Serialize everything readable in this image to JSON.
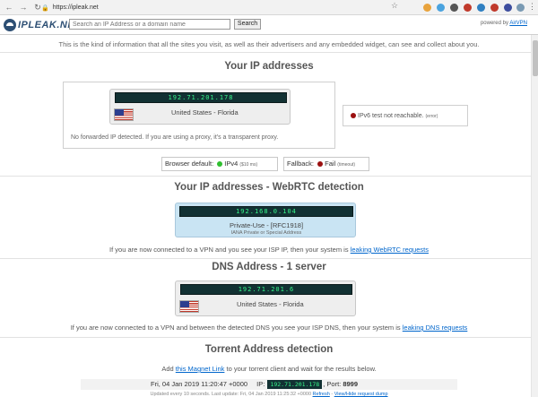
{
  "browser": {
    "url": "https://ipleak.net"
  },
  "header": {
    "logo_text": "IPLEAK.NET",
    "search_placeholder": "Search an IP Address or a domain name",
    "search_button": "Search",
    "powered_by_prefix": "powered by",
    "powered_by_link": "AirVPN"
  },
  "intro": "This is the kind of information that all the sites you visit, as well as their advertisers and any embedded widget, can see and collect about you.",
  "ip_section": {
    "title": "Your IP addresses",
    "ipv4": "192.71.201.178",
    "location": "United States - Florida",
    "no_forward": "No forwarded IP detected. If you are using a proxy, it's a transparent proxy.",
    "ipv6_text": "IPv6 test not reachable.",
    "ipv6_tag": "(error)",
    "browser_default_label": "Browser default:",
    "browser_default_value": "IPv4",
    "browser_default_tag": "($10 ms)",
    "fallback_label": "Fallback:",
    "fallback_value": "Fail",
    "fallback_tag": "(timeout)"
  },
  "webrtc_section": {
    "title": "Your IP addresses - WebRTC detection",
    "ip": "192.168.0.104",
    "label": "Private-Use - [RFC1918]",
    "sublabel": "IANA Private or Special Address",
    "note_prefix": "If you are now connected to a VPN and you see your ISP IP, then your system is",
    "note_link": "leaking WebRTC requests"
  },
  "dns_section": {
    "title": "DNS Address - 1 server",
    "ip": "192.71.201.6",
    "location": "United States - Florida",
    "note_prefix": "If you are now connected to a VPN and between the detected DNS you see your ISP DNS, then your system is",
    "note_link": "leaking DNS requests"
  },
  "torrent_section": {
    "title": "Torrent Address detection",
    "add_prefix": "Add",
    "add_link": "this Magnet Link",
    "add_suffix": "to your torrent client and wait for the results below.",
    "date": "Fri, 04 Jan 2019 11:20:47 +0000",
    "ip_label": "IP:",
    "ip": "192.71.201.178",
    "port_label": ", Port:",
    "port": "8999",
    "updated": "Updated every 10 seconds. Last update: Fri, 04 Jan 2019 11:25:32 +0000",
    "refresh_link": "Refresh",
    "view_link": "View/Hide request dump"
  },
  "colors": {
    "screen_bg": "#123133",
    "screen_text": "#37f58a",
    "error_dot": "#9b1010",
    "ok_dot": "#2fbf2f",
    "link": "#0066cc"
  }
}
